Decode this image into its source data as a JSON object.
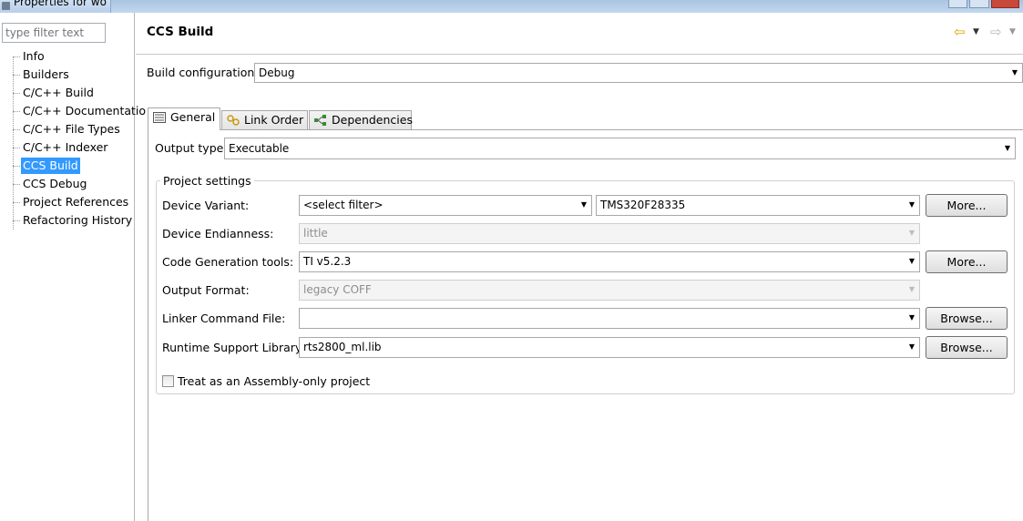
{
  "window": {
    "title": "Properties for wo"
  },
  "left_panel": {
    "filter_placeholder": "type filter text",
    "items": [
      {
        "label": "Info"
      },
      {
        "label": "Builders"
      },
      {
        "label": "C/C++ Build"
      },
      {
        "label": "C/C++ Documentatio"
      },
      {
        "label": "C/C++ File Types"
      },
      {
        "label": "C/C++ Indexer"
      },
      {
        "label": "CCS Build",
        "selected": true
      },
      {
        "label": "CCS Debug"
      },
      {
        "label": "Project References"
      },
      {
        "label": "Refactoring History"
      }
    ]
  },
  "header": {
    "title": "CCS Build",
    "back_icon": "arrow-left-icon",
    "forward_icon": "arrow-right-icon"
  },
  "build_configuration": {
    "label": "Build configuration:",
    "value": "Debug"
  },
  "tabs": [
    {
      "label": "General",
      "icon": "general-icon",
      "active": true
    },
    {
      "label": "Link Order",
      "icon": "link-order-icon"
    },
    {
      "label": "Dependencies",
      "icon": "dependencies-icon"
    }
  ],
  "general": {
    "output_type": {
      "label": "Output type:",
      "value": "Executable"
    },
    "project_settings": {
      "title": "Project settings",
      "device_variant": {
        "label": "Device Variant:",
        "filter": "<select filter>",
        "value": "TMS320F28335",
        "button": "More..."
      },
      "device_endianness": {
        "label": "Device Endianness:",
        "value": "little"
      },
      "code_generation_tools": {
        "label": "Code Generation tools:",
        "value": "TI v5.2.3",
        "button": "More..."
      },
      "output_format": {
        "label": "Output Format:",
        "value": "legacy COFF"
      },
      "linker_command_file": {
        "label": "Linker Command File:",
        "value": "",
        "button": "Browse..."
      },
      "runtime_support_library": {
        "label": "Runtime Support Library:",
        "value": "rts2800_ml.lib",
        "button": "Browse..."
      },
      "assembly_only": {
        "label": "Treat as an Assembly-only project",
        "checked": false
      }
    }
  }
}
